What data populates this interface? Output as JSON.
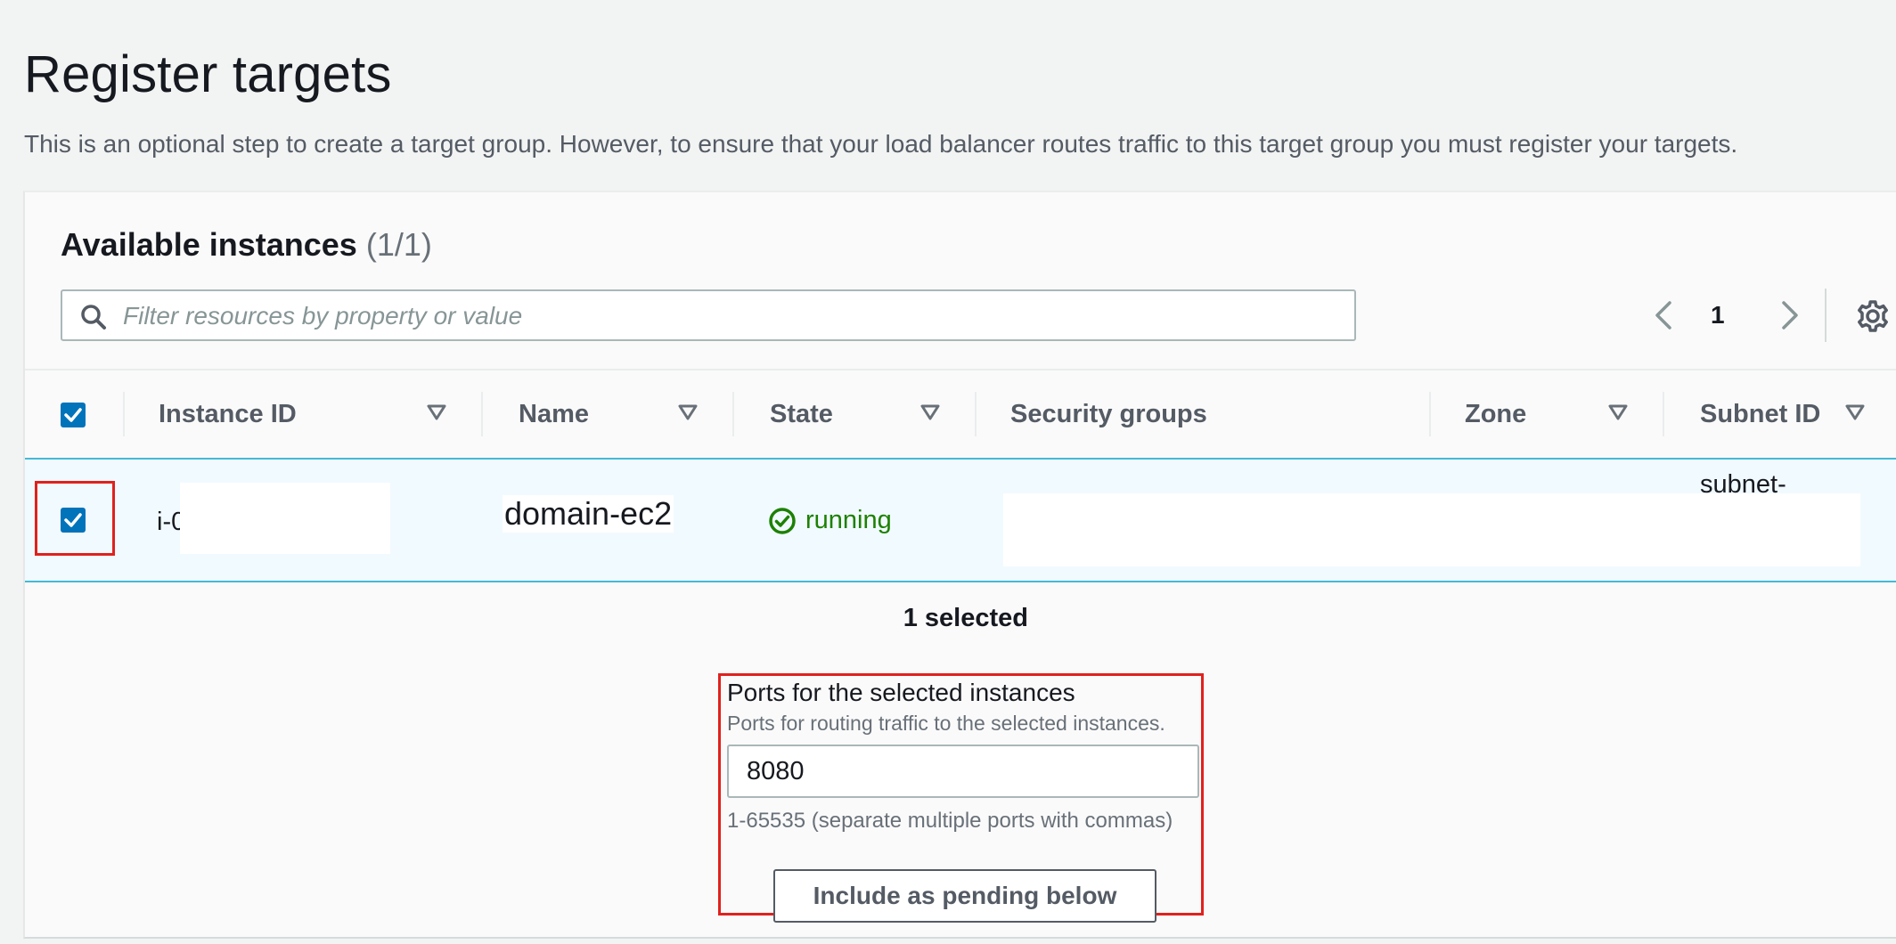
{
  "page": {
    "title": "Register targets",
    "description": "This is an optional step to create a target group. However, to ensure that your load balancer routes traffic to this target group you must register your targets."
  },
  "panel": {
    "title": "Available instances",
    "count": "(1/1)"
  },
  "search": {
    "placeholder": "Filter resources by property or value",
    "value": ""
  },
  "pagination": {
    "current_page": "1"
  },
  "table": {
    "columns": [
      "Instance ID",
      "Name",
      "State",
      "Security groups",
      "Zone",
      "Subnet ID"
    ],
    "rows": [
      {
        "selected": true,
        "instance_id": "i-0",
        "name": "domain-ec2",
        "state": "running",
        "security_groups": "",
        "zone": "",
        "subnet_id": "subnet-"
      }
    ]
  },
  "selection": {
    "summary": "1 selected"
  },
  "ports": {
    "label": "Ports for the selected instances",
    "description": "Ports for routing traffic to the selected instances.",
    "value": "8080",
    "hint": "1-65535 (separate multiple ports with commas)",
    "button_label": "Include as pending below"
  },
  "colors": {
    "accent": "#0073bb",
    "running": "#1d8102",
    "highlight": "#e0211d",
    "selected_row_bg": "#f1faff",
    "selected_row_border": "#44b9d6"
  },
  "icons": {
    "search": "search-icon",
    "prev": "chevron-left-icon",
    "next": "chevron-right-icon",
    "settings": "gear-icon",
    "sort": "sort-down-triangle-icon",
    "status": "check-circle-icon"
  }
}
